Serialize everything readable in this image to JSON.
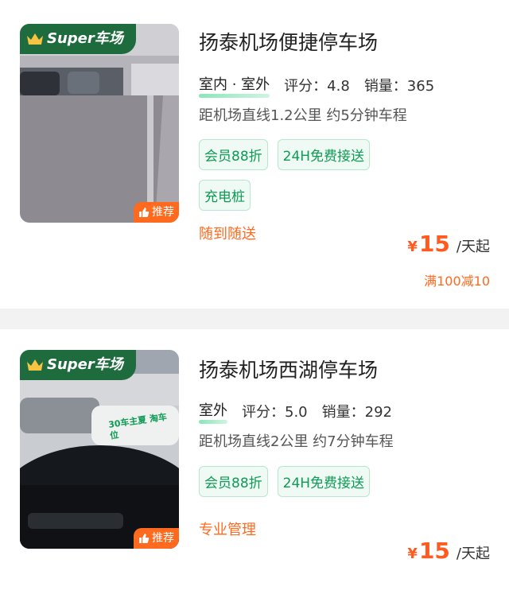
{
  "lots": [
    {
      "badge": "Super车场",
      "recommend": "推荐",
      "name": "扬泰机场便捷停车场",
      "env": "室内 · 室外",
      "rating_label": "评分：4.8",
      "sales_label": "销量：365",
      "distance": "距机场直线1.2公里 约5分钟车程",
      "tags": [
        "会员88折",
        "24H免费接送",
        "充电桩"
      ],
      "service": "随到随送",
      "price_currency": "¥",
      "price_value": "15",
      "price_unit": "/天起",
      "promo": "满100减10"
    },
    {
      "badge": "Super车场",
      "recommend": "推荐",
      "name": "扬泰机场西湖停车场",
      "env": "室外",
      "rating_label": "评分：5.0",
      "sales_label": "销量：292",
      "distance": "距机场直线2公里 约7分钟车程",
      "tags": [
        "会员88折",
        "24H免费接送"
      ],
      "service": "专业管理",
      "price_currency": "¥",
      "price_value": "15",
      "price_unit": "/天起",
      "photo_sign_text": "30车主夏 淘车位"
    }
  ],
  "colors": {
    "accent": "#ff6a1f",
    "green": "#0f9a55",
    "badge_bg": "#1e6b3e"
  },
  "icons": [
    "crown-icon",
    "thumbs-up-icon"
  ]
}
